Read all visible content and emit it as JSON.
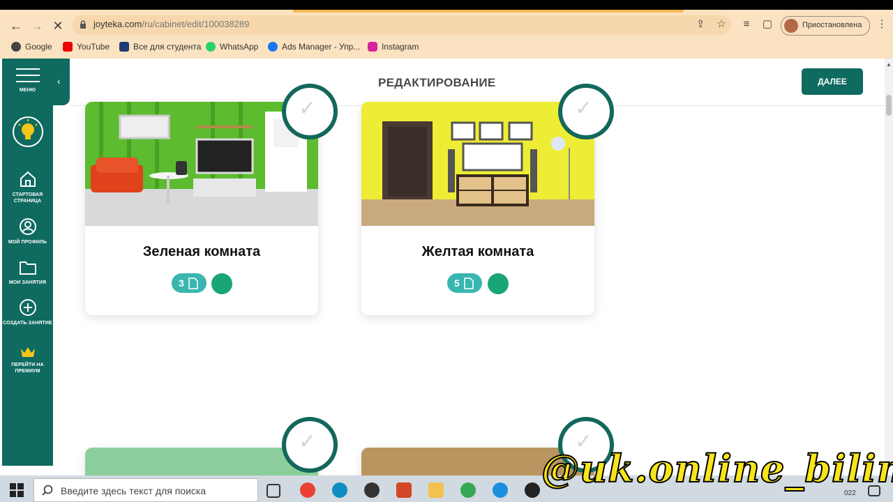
{
  "browser": {
    "url_host": "joyteka.com",
    "url_path": "/ru/cabinet/edit/100038289",
    "profile_label": "Приостановлена",
    "bookmarks": [
      "Google",
      "YouTube",
      "Все для студента",
      "WhatsApp",
      "Ads Manager - Упр...",
      "Instagram"
    ]
  },
  "sidebar": {
    "menu_label": "МЕНЮ",
    "items": [
      {
        "label": "СТАРТОВАЯ СТРАНИЦА"
      },
      {
        "label": "МОЙ ПРОФИЛЬ"
      },
      {
        "label": "МОИ ЗАНЯТИЯ"
      },
      {
        "label": "СОЗДАТЬ ЗАНЯТИЕ"
      },
      {
        "label": "ПЕРЕЙТИ НА ПРЕМИУМ"
      }
    ]
  },
  "header": {
    "title": "РЕДАКТИРОВАНИЕ",
    "next_label": "ДАЛЕЕ"
  },
  "cards": [
    {
      "name": "Зеленая комната",
      "count": "3"
    },
    {
      "name": "Желтая комната",
      "count": "5"
    }
  ],
  "taskbar": {
    "search_placeholder": "Введите здесь текст для поиска",
    "year_fragment": "022"
  },
  "watermark": "@uk.online_bilim",
  "colors": {
    "brand": "#0f6a60",
    "pill": "#39b6b0",
    "dot": "#1aa577"
  }
}
